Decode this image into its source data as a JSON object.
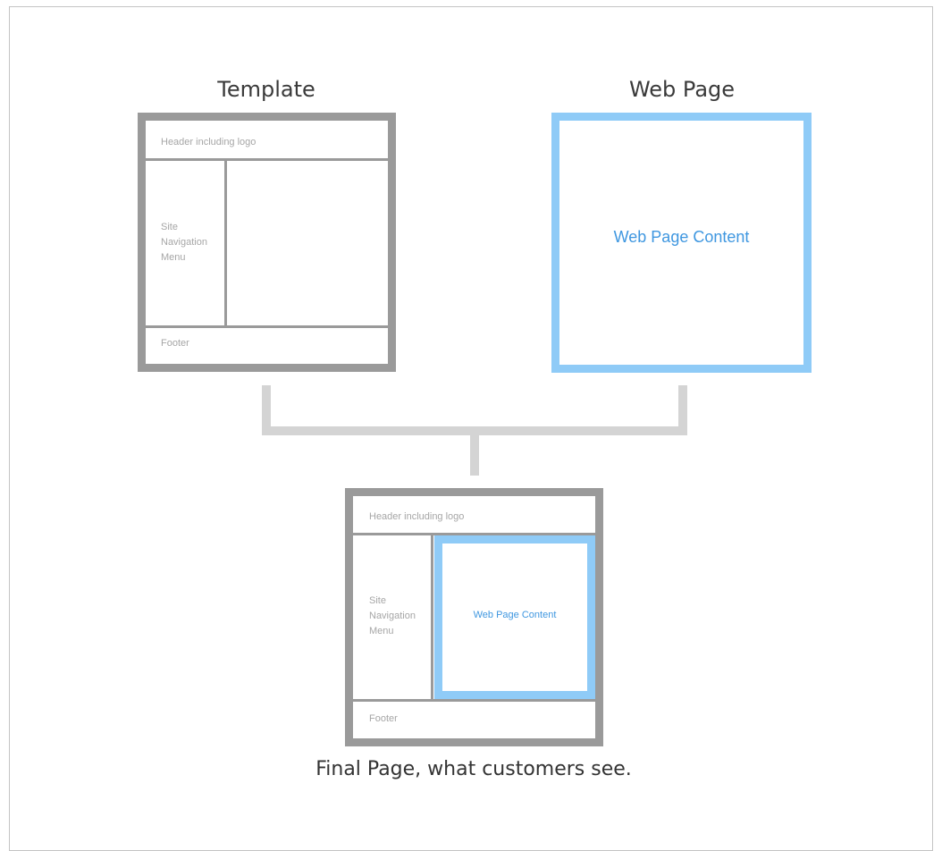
{
  "colors": {
    "template_frame": "#9a9a9a",
    "web_page_frame": "#8fcbf7",
    "content_text": "#3f97e0",
    "connector": "#d4d4d4",
    "label_text": "#a6a6a6"
  },
  "template": {
    "title": "Template",
    "header": "Header including logo",
    "nav_lines": [
      "Site",
      "Navigation",
      "Menu"
    ],
    "footer": "Footer"
  },
  "web_page": {
    "title": "Web Page",
    "content": "Web Page Content"
  },
  "final_page": {
    "header": "Header including logo",
    "nav_lines": [
      "Site",
      "Navigation",
      "Menu"
    ],
    "content": "Web Page Content",
    "footer": "Footer",
    "caption": "Final Page, what customers see."
  }
}
